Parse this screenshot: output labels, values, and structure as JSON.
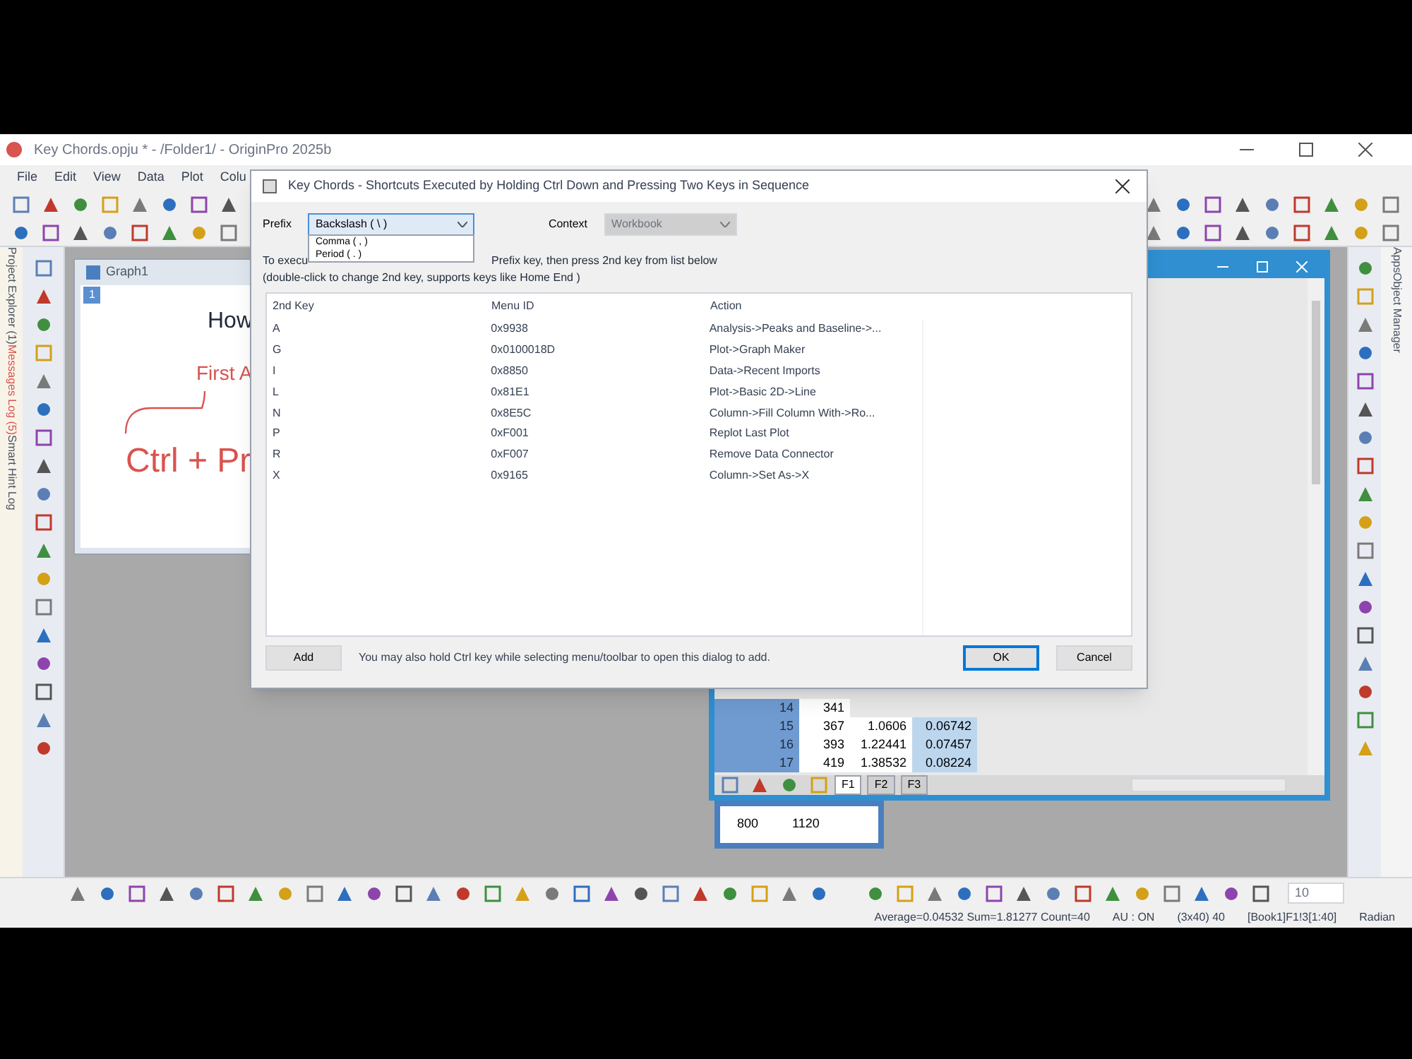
{
  "app": {
    "title": "Key Chords.opju * - /Folder1/ - OriginPro 2025b",
    "menu": [
      "File",
      "Edit",
      "View",
      "Data",
      "Plot",
      "Colu"
    ]
  },
  "left_panels": [
    "Project Explorer (1)",
    "Messages Log (5)",
    "Smart Hint Log"
  ],
  "right_panels": [
    "Apps",
    "Object Manager"
  ],
  "graph": {
    "title": "Graph1",
    "page": "1",
    "heading": "How",
    "subheading": "First A",
    "shortcut": "Ctrl + Pr"
  },
  "workbook": {
    "rows": [
      {
        "row": "14",
        "cells": [
          "341"
        ]
      },
      {
        "row": "15",
        "cells": [
          "367",
          "1.0606",
          "0.06742"
        ]
      },
      {
        "row": "16",
        "cells": [
          "393",
          "1.22441",
          "0.07457"
        ]
      },
      {
        "row": "17",
        "cells": [
          "419",
          "1.38532",
          "0.08224"
        ]
      }
    ],
    "sheets": [
      {
        "label": "F1",
        "selected": true
      },
      {
        "label": "F2",
        "selected": false
      },
      {
        "label": "F3",
        "selected": false
      }
    ]
  },
  "small_window": {
    "cells": [
      "800",
      "1120"
    ]
  },
  "font_size": "10",
  "status_bar": [
    "Average=0.04532 Sum=1.81277 Count=40",
    "AU : ON",
    "(3x40) 40",
    "[Book1]F1!3[1:40]",
    "Radian"
  ],
  "dialog": {
    "title": "Key Chords - Shortcuts Executed by Holding Ctrl Down and Pressing Two Keys in Sequence",
    "prefix_label": "Prefix",
    "prefix_value": "Backslash ( \\ )",
    "prefix_options": [
      {
        "label": "Comma ( , )",
        "selected": false
      },
      {
        "label": "Period ( . )",
        "selected": false
      }
    ],
    "context_label": "Context",
    "context_value": "Workbook",
    "context_disabled": true,
    "hint_start": "To execu",
    "hint_end": "Prefix key, then press 2nd key from list below",
    "hint_line2": "(double-click to change 2nd key, supports keys like Home End )",
    "columns": [
      "2nd Key",
      "Menu ID",
      "Action"
    ],
    "rows": [
      [
        "A",
        "0x9938",
        "Analysis->Peaks and Baseline->..."
      ],
      [
        "G",
        "0x0100018D",
        "Plot->Graph Maker"
      ],
      [
        "I",
        "0x8850",
        "Data->Recent Imports"
      ],
      [
        "L",
        "0x81E1",
        "Plot->Basic 2D->Line"
      ],
      [
        "N",
        "0x8E5C",
        "Column->Fill Column With->Ro..."
      ],
      [
        "P",
        "0xF001",
        "Replot Last Plot"
      ],
      [
        "R",
        "0xF007",
        "Remove Data Connector"
      ],
      [
        "X",
        "0x9165",
        "Column->Set As->X"
      ]
    ],
    "add_button": "Add",
    "note": "You may also hold Ctrl key while selecting menu/toolbar to open this dialog to add.",
    "ok_button": "OK",
    "cancel_button": "Cancel",
    "ok_default": true
  }
}
